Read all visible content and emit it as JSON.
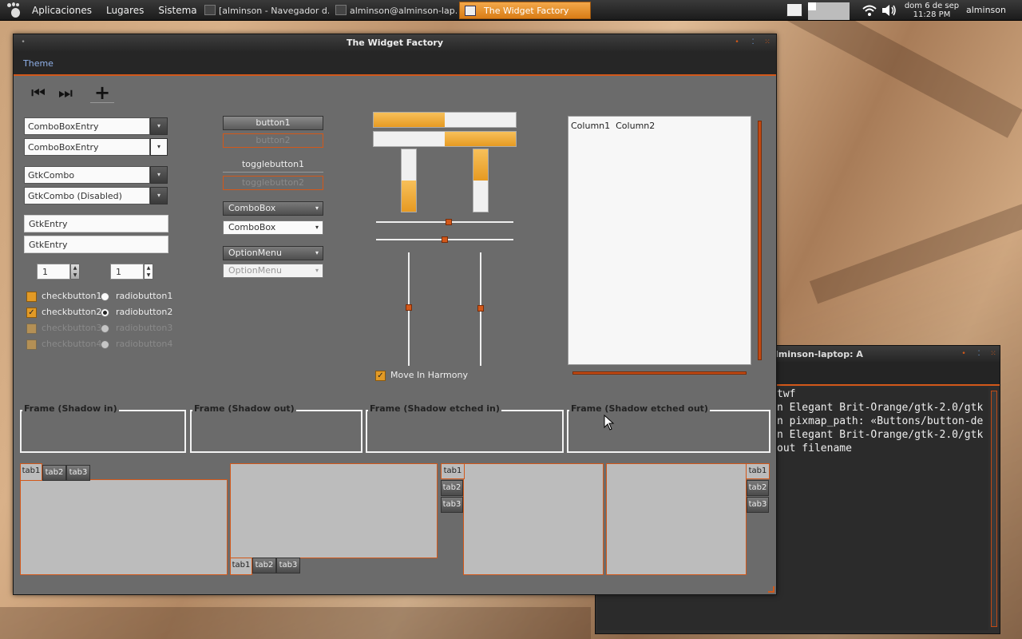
{
  "panel": {
    "applications": "Aplicaciones",
    "places": "Lugares",
    "system": "Sistema",
    "tasks": [
      {
        "label": "[alminson - Navegador d..."
      },
      {
        "label": "alminson@alminson-lap..."
      },
      {
        "label": "The Widget Factory"
      }
    ],
    "clock_date": "dom 6 de sep",
    "clock_time": "11:28 PM",
    "user": "alminson"
  },
  "terminal": {
    "title": "lminson-laptop: A",
    "lines": [
      "twf",
      "n Elegant Brit-Orange/gtk-2.0/gtk",
      "n pixmap_path: «Buttons/button-de",
      "n Elegant Brit-Orange/gtk-2.0/gtk",
      "out filename"
    ]
  },
  "window": {
    "title": "The Widget Factory",
    "menu_theme": "Theme"
  },
  "toolbar": {
    "prev_icon": "⏮",
    "next_icon": "⏭",
    "add_icon": "+"
  },
  "left": {
    "combo_entry_1": "ComboBoxEntry",
    "combo_entry_2": "ComboBoxEntry",
    "gtk_combo": "GtkCombo",
    "gtk_combo_disabled": "GtkCombo (Disabled)",
    "entry_1": "GtkEntry",
    "entry_2": "GtkEntry",
    "spin_1": "1",
    "spin_2": "1",
    "check_1": "checkbutton1",
    "check_2": "checkbutton2",
    "check_3": "checkbutton3",
    "check_4": "checkbutton4",
    "radio_1": "radiobutton1",
    "radio_2": "radiobutton2",
    "radio_3": "radiobutton3",
    "radio_4": "radiobutton4"
  },
  "middle": {
    "button_1": "button1",
    "button_2": "button2",
    "toggle_1": "togglebutton1",
    "toggle_2": "togglebutton2",
    "combobox_1": "ComboBox",
    "combobox_2": "ComboBox",
    "option_1": "OptionMenu",
    "option_2": "OptionMenu"
  },
  "progress": {
    "h1": 0.5,
    "h2": 0.5,
    "v1": 0.5,
    "v2": 0.5
  },
  "scales": {
    "move_in_harmony": "Move In Harmony"
  },
  "tree": {
    "col1": "Column1",
    "col2": "Column2"
  },
  "frames": {
    "shadow_in": "Frame (Shadow in)",
    "shadow_out": "Frame (Shadow out)",
    "etched_in": "Frame (Shadow etched in)",
    "etched_out": "Frame (Shadow etched out)"
  },
  "tabs": {
    "tab1": "tab1",
    "tab2": "tab2",
    "tab3": "tab3"
  },
  "colors": {
    "accent": "#d2581a",
    "progress": "#e69a22"
  }
}
